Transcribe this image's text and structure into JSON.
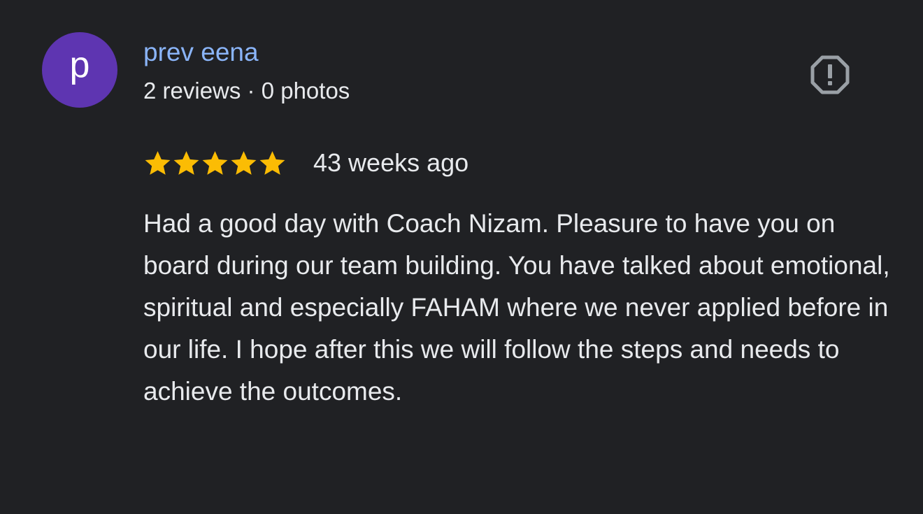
{
  "review": {
    "avatar_letter": "p",
    "author_name": "prev eena",
    "author_meta": "2 reviews · 0 photos",
    "rating": 5,
    "date": "43 weeks ago",
    "text": "Had a good day with Coach Nizam. Pleasure to have you on board during our team building. You have talked about emotional, spiritual and especially FAHAM where we never applied before in our life. I hope after this we will follow the steps and needs to achieve the outcomes.",
    "report_icon": "report-octagon-icon"
  },
  "colors": {
    "background": "#202124",
    "avatar": "#5e35b1",
    "author_name": "#8ab4f8",
    "star": "#fbbc04",
    "text": "#e8eaed",
    "icon": "#9aa0a6"
  }
}
